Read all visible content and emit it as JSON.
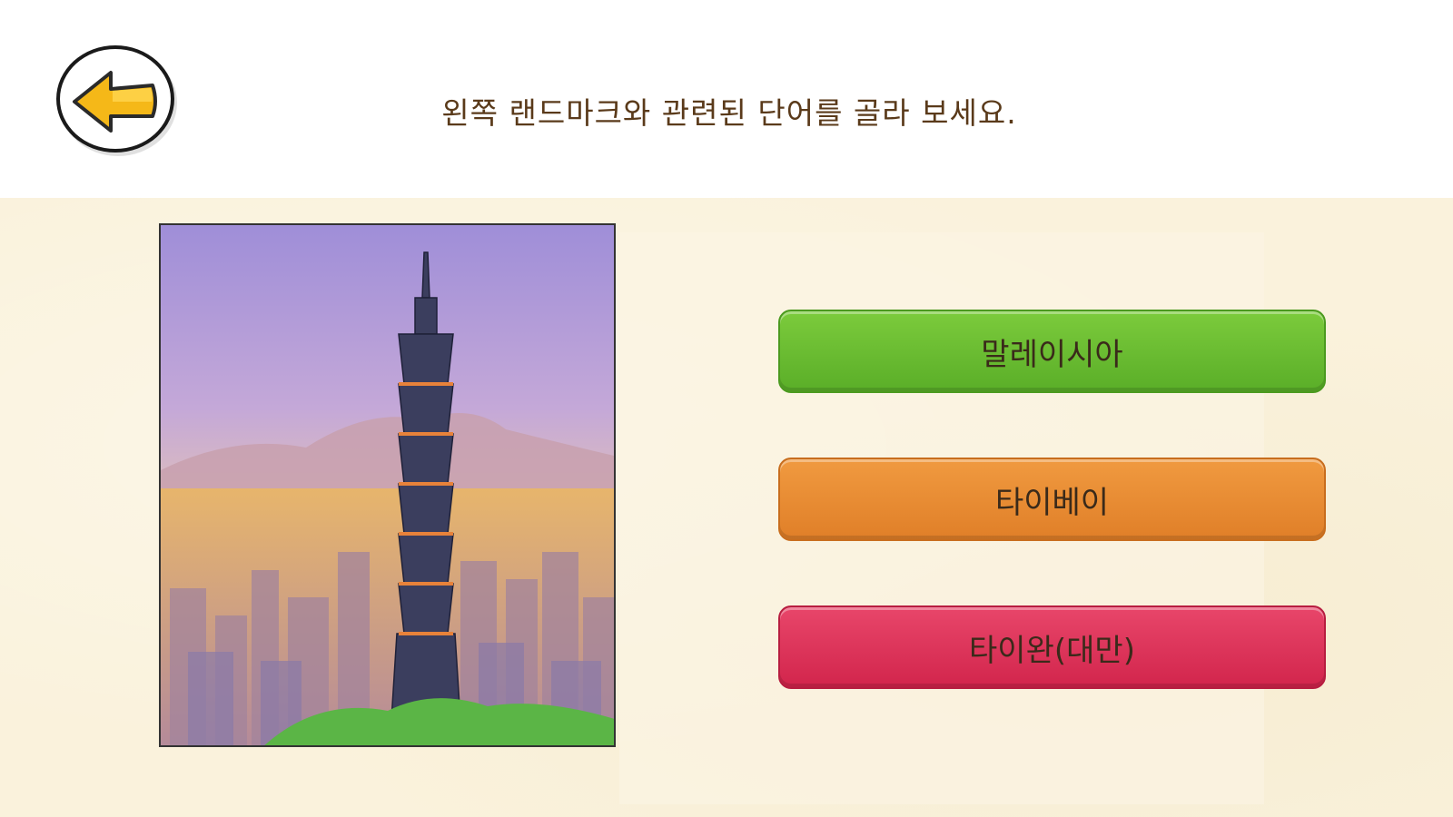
{
  "header": {
    "instruction": "왼쪽 랜드마크와 관련된 단어를 골라 보세요."
  },
  "back_button": {
    "icon": "arrow-left-icon"
  },
  "landmark": {
    "subject": "Taipei 101 watercolor"
  },
  "options": [
    {
      "label": "말레이시아",
      "color": "#6bbd30"
    },
    {
      "label": "타이베이",
      "color": "#e88a32"
    },
    {
      "label": "타이완(대만)",
      "color": "#dc3358"
    }
  ]
}
